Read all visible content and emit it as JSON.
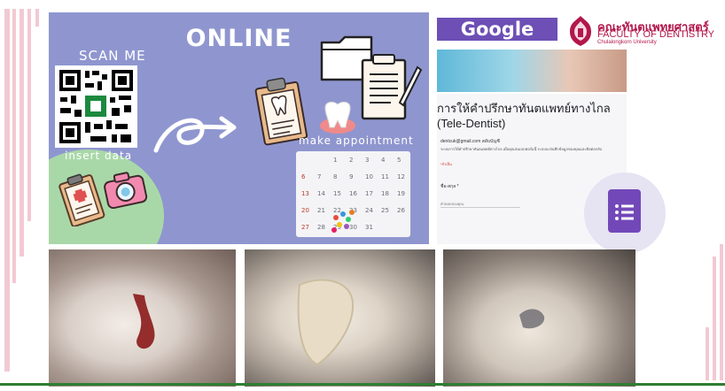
{
  "panel": {
    "title": "ONLINE",
    "scan_label": "SCAN ME",
    "insert_label": "insert data",
    "appointment_label": "make appointment",
    "calendar_days": [
      [
        "",
        "",
        "1",
        "2",
        "3",
        "4",
        "5"
      ],
      [
        "6",
        "7",
        "8",
        "9",
        "10",
        "11",
        "12"
      ],
      [
        "13",
        "14",
        "15",
        "16",
        "17",
        "18",
        "19"
      ],
      [
        "20",
        "21",
        "22",
        "23",
        "24",
        "25",
        "26"
      ],
      [
        "27",
        "28",
        "29",
        "30",
        "31",
        "",
        ""
      ]
    ]
  },
  "forms": {
    "badge": "Google forms",
    "faculty_thai": "คณะทันตแพทยศาสตร์",
    "faculty_english": "FACULTY OF DENTISTRY",
    "faculty_university": "Chulalongkorn University",
    "form_title": "การให้คำปรึกษาทันตแพทย์ทางไกล (Tele-Dentist)",
    "account_email": "dentcuk@gmail.com สลับบัญชี",
    "description": "ระบบการให้คำปรึกษาทันตแพทย์ทางไกล เมื่อคุณส่งแบบฟอร์มนี้ ระบบจะบันทึกข้อมูลของคุณและติดต่อกลับ",
    "required_note": "*จำเป็น",
    "name_field_label": "ชื่อ-สกุล *",
    "answer_placeholder": "คำตอบของคุณ"
  },
  "colors": {
    "panel_purple": "#8f96cf",
    "forms_badge_purple": "#6d4fb5",
    "faculty_magenta": "#b2174b",
    "accent_green": "#2e7d32",
    "stripe_pink": "#f2c9d3"
  }
}
